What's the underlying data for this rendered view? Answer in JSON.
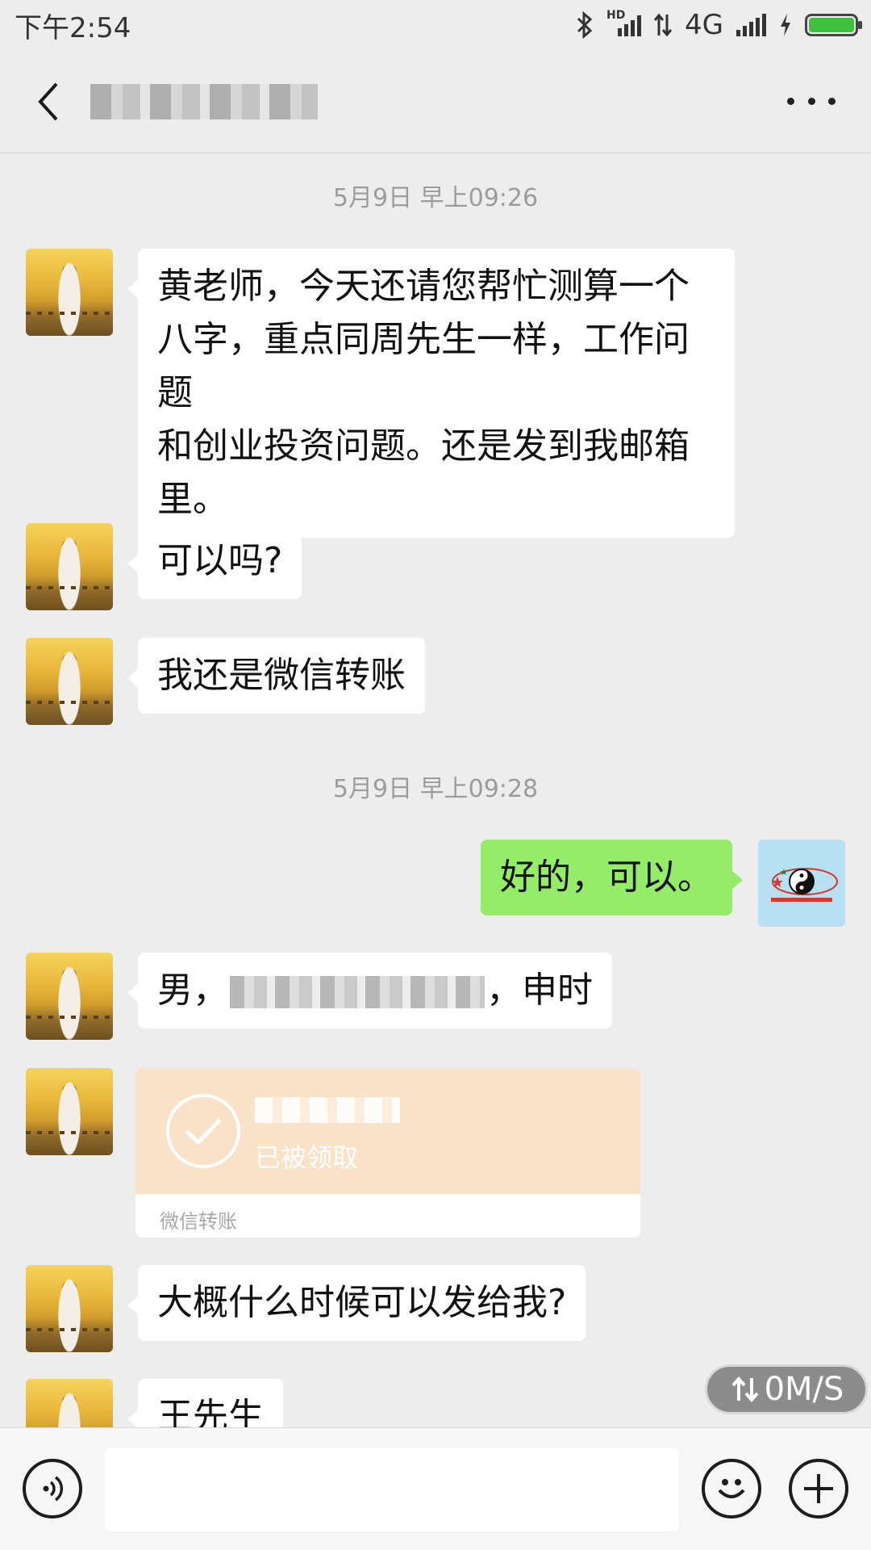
{
  "status_bar": {
    "time": "下午2:54",
    "network": "4G",
    "hd_label": "HD"
  },
  "title_bar": {
    "title": "",
    "back_icon": "chevron-left-icon",
    "more_icon": "ellipsis-icon"
  },
  "messages": [
    {
      "type": "timestamp",
      "text": "5月9日 早上09:26"
    },
    {
      "type": "text",
      "sender": "other",
      "lines": [
        "黄老师，今天还请您帮忙测算一个",
        "八字，重点同周先生一样，工作问题",
        "和创业投资问题。还是发到我邮箱",
        "里。"
      ]
    },
    {
      "type": "text",
      "sender": "other",
      "text": "可以吗?"
    },
    {
      "type": "text",
      "sender": "other",
      "text": "我还是微信转账"
    },
    {
      "type": "timestamp",
      "text": "5月9日 早上09:28"
    },
    {
      "type": "text",
      "sender": "me",
      "text": "好的，可以。"
    },
    {
      "type": "text",
      "sender": "other",
      "prefix": "男，",
      "suffix": "，申时"
    },
    {
      "type": "transfer",
      "sender": "other",
      "status": "已被领取",
      "footer": "微信转账"
    },
    {
      "type": "text",
      "sender": "other",
      "text": "大概什么时候可以发给我?"
    },
    {
      "type": "text",
      "sender": "other",
      "text": "王先生"
    }
  ],
  "net_speed": "0M/S",
  "input_bar": {
    "voice_icon": "voice-icon",
    "emoji_icon": "emoji-icon",
    "plus_icon": "plus-icon",
    "text_value": ""
  },
  "colors": {
    "background": "#ededed",
    "my_bubble": "#95ec69",
    "transfer_card": "#fae2c9"
  }
}
